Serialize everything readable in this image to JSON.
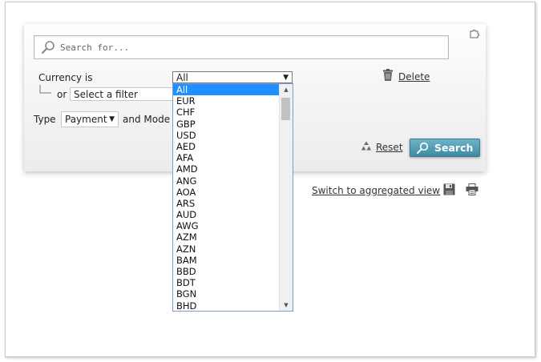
{
  "search": {
    "placeholder": "Search for..."
  },
  "filters": {
    "currency_label": "Currency is",
    "or_label": "or",
    "filter_select_value": "Select a filter",
    "currency_value": "All",
    "type_label": "Type",
    "type_value": "Payment",
    "mode_label": "and Mode is"
  },
  "actions": {
    "delete_label": "Delete",
    "reset_label": "Reset",
    "search_label": "Search"
  },
  "footer": {
    "aggregated_link": "Switch to aggregated view",
    "separator": "·"
  },
  "currency_options": [
    "All",
    "EUR",
    "CHF",
    "GBP",
    "USD",
    "AED",
    "AFA",
    "AMD",
    "ANG",
    "AOA",
    "ARS",
    "AUD",
    "AWG",
    "AZM",
    "AZN",
    "BAM",
    "BBD",
    "BDT",
    "BGN",
    "BHD"
  ],
  "selected_option_index": 0,
  "colors": {
    "accent": "#1e90ff",
    "search_button": "#4a9ab3"
  }
}
